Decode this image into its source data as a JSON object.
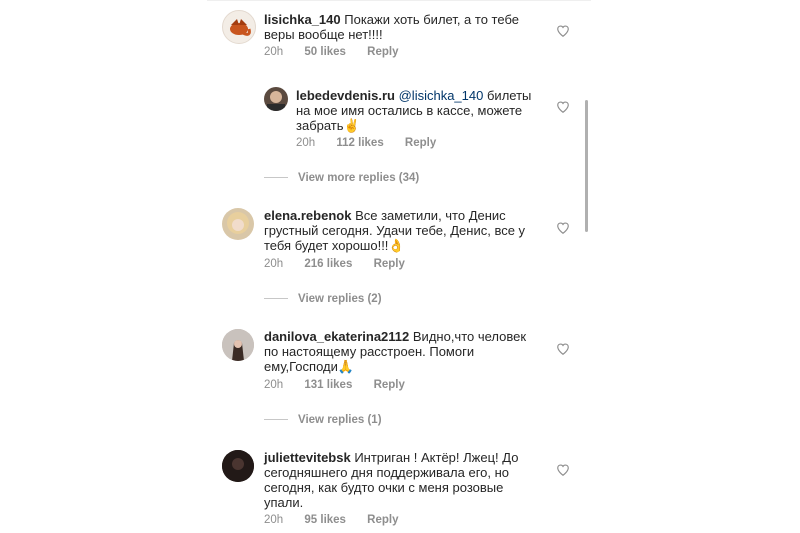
{
  "comments": [
    {
      "username": "lisichka_140",
      "text_before": "Покажи хоть билет, а то тебе",
      "text_line2": "веры вообще нет!!!!",
      "time": "20h",
      "likes": "50 likes",
      "reply": "Reply"
    },
    {
      "username": "lebedevdenis.ru",
      "mention": "@lisichka_140",
      "text_line1_end": "билеты",
      "text_line2": "на мое имя остались в кассе, можете",
      "text_line3": "забрать✌",
      "time": "20h",
      "likes": "112 likes",
      "reply": "Reply",
      "view_replies": "View more replies (34)"
    },
    {
      "username": "elena.rebenok",
      "text_line1": "Все заметили, что Денис",
      "text_line2": "грустный сегодня. Удачи тебе, Денис, все у",
      "text_line3": "тебя будет хорошо!!!👌",
      "time": "20h",
      "likes": "216 likes",
      "reply": "Reply",
      "view_replies": "View replies (2)"
    },
    {
      "username": "danilova_ekaterina2112",
      "text_line1": "Видно,что человек",
      "text_line2": "по настоящему расстроен. Помоги",
      "text_line3": "ему,Господи🙏",
      "time": "20h",
      "likes": "131 likes",
      "reply": "Reply",
      "view_replies": "View replies (1)"
    },
    {
      "username": "juliettevitebsk",
      "text_line1": "Интриган ! Актёр! Лжец! До",
      "text_line2": "сегодняшнего дня поддерживала его, но",
      "text_line3": "сегодня, как будто очки с меня розовые",
      "text_line4": "упали.",
      "time": "20h",
      "likes": "95 likes",
      "reply": "Reply"
    }
  ],
  "icons": {
    "like": "heart-icon"
  }
}
